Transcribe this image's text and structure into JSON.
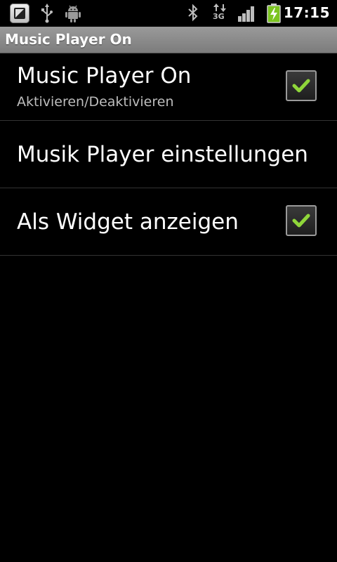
{
  "status_bar": {
    "time": "17:15",
    "icons": [
      "app-notification-icon",
      "usb-icon",
      "android-debug-icon",
      "bluetooth-icon",
      "3g-data-icon",
      "signal-strength-icon",
      "battery-charging-icon"
    ],
    "network_type": "3G"
  },
  "title_bar": {
    "title": "Music Player On"
  },
  "preferences": [
    {
      "title": "Music Player On",
      "summary": "Aktivieren/Deaktivieren",
      "checked": true
    },
    {
      "title": "Musik Player einstellungen"
    },
    {
      "title": "Als Widget anzeigen",
      "checked": true
    }
  ],
  "colors": {
    "accent_check": "#8fd63a",
    "title_bar": "#8a8a8a",
    "divider": "#333333"
  }
}
